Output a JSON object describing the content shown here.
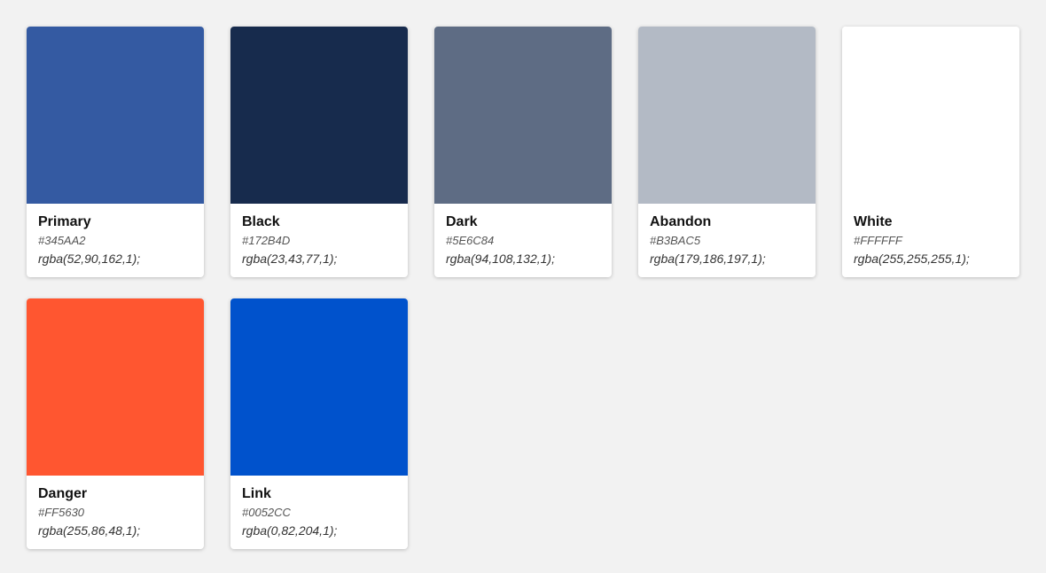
{
  "colors": [
    {
      "name": "Primary",
      "hex": "#345AA2",
      "rgba": "rgba(52,90,162,1);"
    },
    {
      "name": "Black",
      "hex": "#172B4D",
      "rgba": "rgba(23,43,77,1);"
    },
    {
      "name": "Dark",
      "hex": "#5E6C84",
      "rgba": "rgba(94,108,132,1);"
    },
    {
      "name": "Abandon",
      "hex": "#B3BAC5",
      "rgba": "rgba(179,186,197,1);"
    },
    {
      "name": "White",
      "hex": "#FFFFFF",
      "rgba": "rgba(255,255,255,1);"
    },
    {
      "name": "Danger",
      "hex": "#FF5630",
      "rgba": "rgba(255,86,48,1);"
    },
    {
      "name": "Link",
      "hex": "#0052CC",
      "rgba": "rgba(0,82,204,1);"
    }
  ]
}
